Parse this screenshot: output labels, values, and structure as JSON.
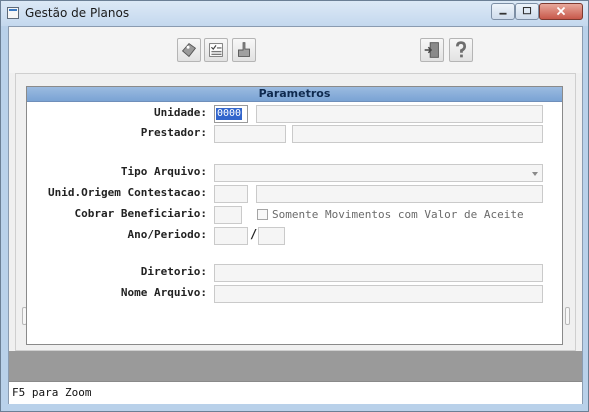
{
  "window": {
    "title": "Gestão de Planos",
    "controls": [
      "minimize-icon",
      "maximize-icon",
      "close-icon"
    ]
  },
  "toolbar": {
    "left_group": [
      "edit-tag-icon",
      "checklist-icon",
      "hand-pointer-icon"
    ],
    "right_group": [
      "exit-door-icon",
      "help-question-icon"
    ]
  },
  "panel": {
    "title": "Parametros",
    "labels": {
      "unidade": "Unidade:",
      "prestador": "Prestador:",
      "tipo_arquivo": "Tipo Arquivo:",
      "unid_origem": "Unid.Origem Contestacao:",
      "cobrar_beneficiario": "Cobrar Beneficiario:",
      "ano_periodo": "Ano/Periodo:",
      "diretorio": "Diretorio:",
      "nome_arquivo": "Nome Arquivo:"
    },
    "values": {
      "unidade": "0000",
      "unidade_desc": "",
      "prestador": "",
      "prestador_desc": "",
      "tipo_arquivo": "",
      "unid_origem": "",
      "unid_origem_desc": "",
      "cobrar_beneficiario": "",
      "ano": "",
      "periodo": "",
      "diretorio": "",
      "nome_arquivo": ""
    },
    "checkbox": {
      "label": "Somente Movimentos com Valor de Aceite",
      "checked": false
    },
    "separator": "/"
  },
  "status": {
    "text": "F5 para Zoom"
  },
  "colors": {
    "titlebar": "#c4d8ee",
    "panel_header": "#7aa3d4",
    "selection": "#3366cc",
    "bottom_band": "#9a9a9a"
  }
}
